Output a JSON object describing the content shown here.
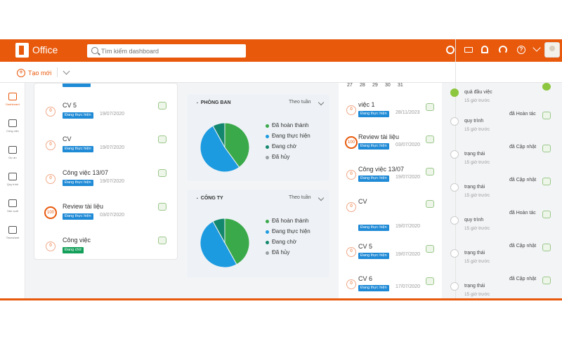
{
  "app": {
    "title": "Office"
  },
  "search": {
    "placeholder": "Tìm kiếm dashboard"
  },
  "toolbar": {
    "create_label": "Tạo mới"
  },
  "sidebar": {
    "items": [
      {
        "label": "Dashboard",
        "icon": "dashboard-icon"
      },
      {
        "label": "Công việc",
        "icon": "clipboard-icon"
      },
      {
        "label": "Dự án",
        "icon": "briefcase-icon"
      },
      {
        "label": "Quy trình",
        "icon": "workflow-icon"
      },
      {
        "label": "Sản xuất",
        "icon": "share-icon"
      },
      {
        "label": "Timesheet",
        "icon": "clock-icon"
      }
    ]
  },
  "left_tasks": [
    {
      "title": "CV 5",
      "status": "Đang thực hiện",
      "date": "19/07/2020",
      "progress": "0"
    },
    {
      "title": "CV",
      "status": "Đang thực hiện",
      "date": "19/07/2020",
      "progress": "0"
    },
    {
      "title": "Công việc 13/07",
      "status": "Đang thực hiện",
      "date": "19/07/2020",
      "progress": "0"
    },
    {
      "title": "Review tài liệu",
      "status": "Đang thực hiện",
      "date": "03/07/2020",
      "progress": "100"
    },
    {
      "title": "Công việc",
      "status": "Đang chờ",
      "date": "",
      "progress": "0"
    }
  ],
  "panels": [
    {
      "title": "PHÒNG BAN",
      "period": "Theo tuần"
    },
    {
      "title": "CÔNG TY",
      "period": "Theo tuần"
    }
  ],
  "legend": [
    {
      "label": "Đã hoàn thành",
      "color": "#3aa94a"
    },
    {
      "label": "Đang thực hiện",
      "color": "#1d9be0"
    },
    {
      "label": "Đang chờ",
      "color": "#13876d"
    },
    {
      "label": "Đã hủy",
      "color": "#9aa0a6"
    }
  ],
  "chart_data": [
    {
      "type": "pie",
      "title": "PHÒNG BAN",
      "categories": [
        "Đã hoàn thành",
        "Đang thực hiện",
        "Đang chờ",
        "Đã hủy"
      ],
      "values": [
        40,
        52,
        8,
        0
      ]
    },
    {
      "type": "pie",
      "title": "CÔNG TY",
      "categories": [
        "Đã hoàn thành",
        "Đang thực hiện",
        "Đang chờ",
        "Đã hủy"
      ],
      "values": [
        42,
        50,
        8,
        0
      ]
    }
  ],
  "calendar": {
    "days": [
      "27",
      "28",
      "29",
      "30",
      "31"
    ]
  },
  "mid_tasks": [
    {
      "title": "việc 1",
      "status": "Đang thực hiện",
      "date": "28/11/2023",
      "progress": "0"
    },
    {
      "title": "Review tài liệu",
      "status": "Đang thực hiện",
      "date": "03/07/2020",
      "progress": "100"
    },
    {
      "title": "Công việc 13/07",
      "status": "Đang thực hiện",
      "date": "19/07/2020",
      "progress": "0"
    },
    {
      "title": "CV",
      "status": "Đang thực hiện",
      "date": "19/07/2020",
      "progress": "0"
    },
    {
      "title": "CV 5",
      "status": "Đang thực hiện",
      "date": "19/07/2020",
      "progress": "0"
    },
    {
      "title": "CV 6",
      "status": "Đang thực hiện",
      "date": "17/07/2020",
      "progress": "0"
    }
  ],
  "activity": [
    {
      "action": "",
      "subject": "quả đầu việc",
      "time": "15 giờ trước"
    },
    {
      "action": "đã Hoàn tác",
      "subject": "quy trình",
      "time": "15 giờ trước"
    },
    {
      "action": "đã Cập nhật",
      "subject": "trạng thái",
      "time": "15 giờ trước"
    },
    {
      "action": "đã Cập nhật",
      "subject": "trạng thái",
      "time": "15 giờ trước"
    },
    {
      "action": "đã Hoàn tác",
      "subject": "quy trình",
      "time": "15 giờ trước"
    },
    {
      "action": "đã Cập nhật",
      "subject": "trạng thái",
      "time": "15 giờ trước"
    },
    {
      "action": "đã Cập nhật",
      "subject": "trạng thái",
      "time": "15 giờ trước"
    }
  ]
}
